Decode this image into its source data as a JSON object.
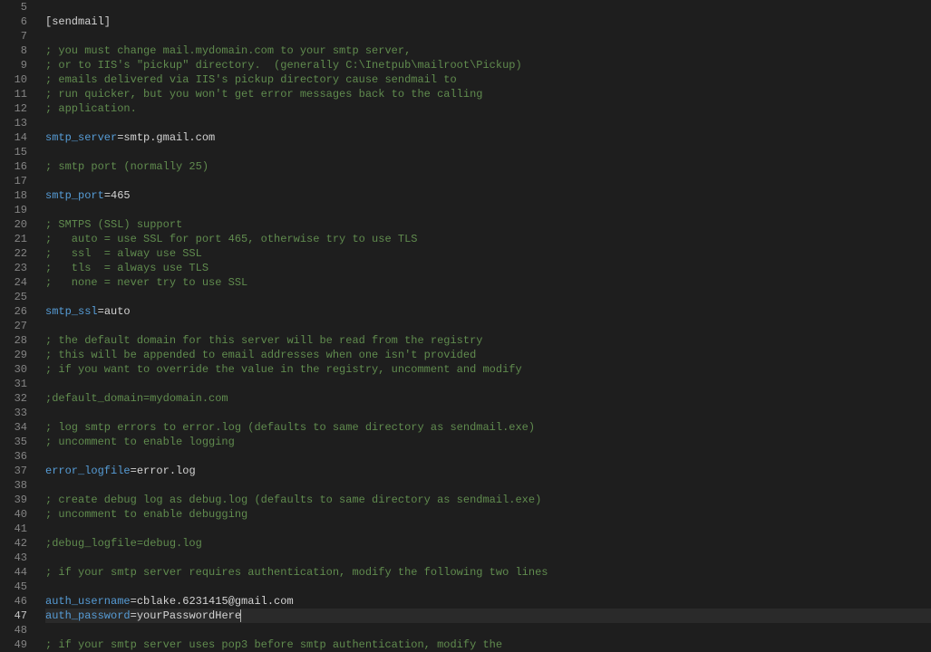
{
  "editor": {
    "startLine": 5,
    "currentLine": 47,
    "lines": [
      {
        "n": 5,
        "segs": []
      },
      {
        "n": 6,
        "segs": [
          {
            "cls": "section",
            "t": "[sendmail]"
          }
        ]
      },
      {
        "n": 7,
        "segs": []
      },
      {
        "n": 8,
        "segs": [
          {
            "cls": "comment",
            "t": "; you must change mail.mydomain.com to your smtp server,"
          }
        ]
      },
      {
        "n": 9,
        "segs": [
          {
            "cls": "comment",
            "t": "; or to IIS's \"pickup\" directory.  (generally C:\\Inetpub\\mailroot\\Pickup)"
          }
        ]
      },
      {
        "n": 10,
        "segs": [
          {
            "cls": "comment",
            "t": "; emails delivered via IIS's pickup directory cause sendmail to"
          }
        ]
      },
      {
        "n": 11,
        "segs": [
          {
            "cls": "comment",
            "t": "; run quicker, but you won't get error messages back to the calling"
          }
        ]
      },
      {
        "n": 12,
        "segs": [
          {
            "cls": "comment",
            "t": "; application."
          }
        ]
      },
      {
        "n": 13,
        "segs": []
      },
      {
        "n": 14,
        "segs": [
          {
            "cls": "key",
            "t": "smtp_server"
          },
          {
            "cls": "eq",
            "t": "="
          },
          {
            "cls": "value",
            "t": "smtp.gmail.com"
          }
        ]
      },
      {
        "n": 15,
        "segs": []
      },
      {
        "n": 16,
        "segs": [
          {
            "cls": "comment",
            "t": "; smtp port (normally 25)"
          }
        ]
      },
      {
        "n": 17,
        "segs": []
      },
      {
        "n": 18,
        "segs": [
          {
            "cls": "key",
            "t": "smtp_port"
          },
          {
            "cls": "eq",
            "t": "="
          },
          {
            "cls": "value",
            "t": "465"
          }
        ]
      },
      {
        "n": 19,
        "segs": []
      },
      {
        "n": 20,
        "segs": [
          {
            "cls": "comment",
            "t": "; SMTPS (SSL) support"
          }
        ]
      },
      {
        "n": 21,
        "segs": [
          {
            "cls": "comment",
            "t": ";   auto = use SSL for port 465, otherwise try to use TLS"
          }
        ]
      },
      {
        "n": 22,
        "segs": [
          {
            "cls": "comment",
            "t": ";   ssl  = alway use SSL"
          }
        ]
      },
      {
        "n": 23,
        "segs": [
          {
            "cls": "comment",
            "t": ";   tls  = always use TLS"
          }
        ]
      },
      {
        "n": 24,
        "segs": [
          {
            "cls": "comment",
            "t": ";   none = never try to use SSL"
          }
        ]
      },
      {
        "n": 25,
        "segs": []
      },
      {
        "n": 26,
        "segs": [
          {
            "cls": "key",
            "t": "smtp_ssl"
          },
          {
            "cls": "eq",
            "t": "="
          },
          {
            "cls": "value",
            "t": "auto"
          }
        ]
      },
      {
        "n": 27,
        "segs": []
      },
      {
        "n": 28,
        "segs": [
          {
            "cls": "comment",
            "t": "; the default domain for this server will be read from the registry"
          }
        ]
      },
      {
        "n": 29,
        "segs": [
          {
            "cls": "comment",
            "t": "; this will be appended to email addresses when one isn't provided"
          }
        ]
      },
      {
        "n": 30,
        "segs": [
          {
            "cls": "comment",
            "t": "; if you want to override the value in the registry, uncomment and modify"
          }
        ]
      },
      {
        "n": 31,
        "segs": []
      },
      {
        "n": 32,
        "segs": [
          {
            "cls": "comment",
            "t": ";default_domain=mydomain.com"
          }
        ]
      },
      {
        "n": 33,
        "segs": []
      },
      {
        "n": 34,
        "segs": [
          {
            "cls": "comment",
            "t": "; log smtp errors to error.log (defaults to same directory as sendmail.exe)"
          }
        ]
      },
      {
        "n": 35,
        "segs": [
          {
            "cls": "comment",
            "t": "; uncomment to enable logging"
          }
        ]
      },
      {
        "n": 36,
        "segs": []
      },
      {
        "n": 37,
        "segs": [
          {
            "cls": "key",
            "t": "error_logfile"
          },
          {
            "cls": "eq",
            "t": "="
          },
          {
            "cls": "value",
            "t": "error.log"
          }
        ]
      },
      {
        "n": 38,
        "segs": []
      },
      {
        "n": 39,
        "segs": [
          {
            "cls": "comment",
            "t": "; create debug log as debug.log (defaults to same directory as sendmail.exe)"
          }
        ]
      },
      {
        "n": 40,
        "segs": [
          {
            "cls": "comment",
            "t": "; uncomment to enable debugging"
          }
        ]
      },
      {
        "n": 41,
        "segs": []
      },
      {
        "n": 42,
        "segs": [
          {
            "cls": "comment",
            "t": ";debug_logfile=debug.log"
          }
        ]
      },
      {
        "n": 43,
        "segs": []
      },
      {
        "n": 44,
        "segs": [
          {
            "cls": "comment",
            "t": "; if your smtp server requires authentication, modify the following two lines"
          }
        ]
      },
      {
        "n": 45,
        "segs": []
      },
      {
        "n": 46,
        "segs": [
          {
            "cls": "key",
            "t": "auth_username"
          },
          {
            "cls": "eq",
            "t": "="
          },
          {
            "cls": "value",
            "t": "cblake.6231415@gmail.com"
          }
        ]
      },
      {
        "n": 47,
        "segs": [
          {
            "cls": "key",
            "t": "auth_password"
          },
          {
            "cls": "eq",
            "t": "="
          },
          {
            "cls": "value",
            "t": "yourPasswordHere"
          }
        ],
        "cursor": true
      },
      {
        "n": 48,
        "segs": []
      },
      {
        "n": 49,
        "segs": [
          {
            "cls": "comment",
            "t": "; if your smtp server uses pop3 before smtp authentication, modify the"
          }
        ]
      }
    ]
  }
}
